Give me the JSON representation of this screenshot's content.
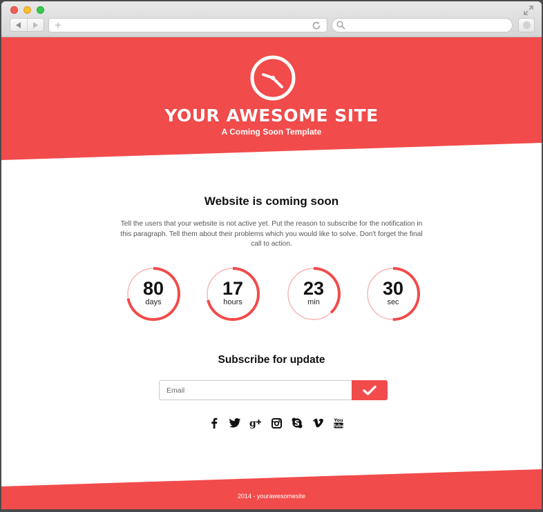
{
  "browser": {
    "url": "",
    "search_placeholder": ""
  },
  "header": {
    "site_title": "YOUR AWESOME SITE",
    "subtitle": "A Coming Soon Template"
  },
  "main": {
    "heading": "Website is coming soon",
    "paragraph": "Tell the users that your website is not active yet. Put the reason to subscribe for the notification in this paragraph. Tell them about their problems which you would like to solve. Don't forget the final call to action."
  },
  "countdown": [
    {
      "value": "80",
      "unit": "days",
      "progress": 0.72
    },
    {
      "value": "17",
      "unit": "hours",
      "progress": 0.71
    },
    {
      "value": "23",
      "unit": "min",
      "progress": 0.38
    },
    {
      "value": "30",
      "unit": "sec",
      "progress": 0.5
    }
  ],
  "subscribe": {
    "heading": "Subscribe for update",
    "email_placeholder": "Email"
  },
  "social": [
    "facebook-icon",
    "twitter-icon",
    "google-plus-icon",
    "instagram-icon",
    "skype-icon",
    "vimeo-icon",
    "youtube-icon"
  ],
  "footer": {
    "text": "2014 - yourawesomesite"
  },
  "colors": {
    "accent": "#f24b4b",
    "ring_track": "#f6b3b3",
    "text": "#111111"
  }
}
